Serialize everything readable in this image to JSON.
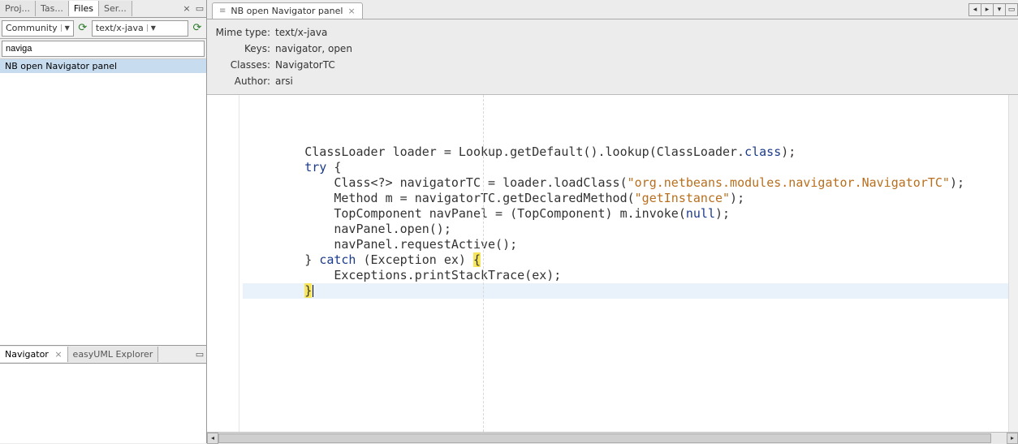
{
  "left": {
    "tabs": [
      "Proj...",
      "Tas...",
      "Files",
      "Ser..."
    ],
    "active_tab_index": 2,
    "combo1": "Community",
    "combo2": "text/x-java",
    "filter_value": "naviga",
    "tree_item": "NB open Navigator panel"
  },
  "bottom": {
    "tabs": [
      {
        "label": "Navigator",
        "closable": true
      },
      {
        "label": "easyUML Explorer",
        "closable": false
      }
    ]
  },
  "editor": {
    "tab_label": "NB open Navigator panel",
    "meta": {
      "mimetype_label": "Mime type:",
      "mimetype_value": "text/x-java",
      "keys_label": "Keys:",
      "keys_value": "navigator, open",
      "classes_label": "Classes:",
      "classes_value": "NavigatorTC",
      "author_label": "Author:",
      "author_value": "arsi"
    }
  },
  "code": {
    "l1a": "        ClassLoader loader = Lookup.getDefault().lookup(ClassLoader.",
    "l1b": "class",
    "l1c": ");",
    "l2a": "        ",
    "l2b": "try",
    "l2c": " {",
    "l3a": "            Class<?> navigatorTC = loader.loadClass(",
    "l3b": "\"org.netbeans.modules.navigator.NavigatorTC\"",
    "l3c": ");",
    "l4a": "            Method m = navigatorTC.getDeclaredMethod(",
    "l4b": "\"getInstance\"",
    "l4c": ");",
    "l5a": "            TopComponent navPanel = (TopComponent) m.invoke(",
    "l5b": "null",
    "l5c": ");",
    "l6": "            navPanel.open();",
    "l7": "            navPanel.requestActive();",
    "l8a": "        } ",
    "l8b": "catch",
    "l8c": " (Exception ex) ",
    "l8d": "{",
    "l9": "            Exceptions.printStackTrace(ex);",
    "l10a": "        ",
    "l10b": "}"
  }
}
